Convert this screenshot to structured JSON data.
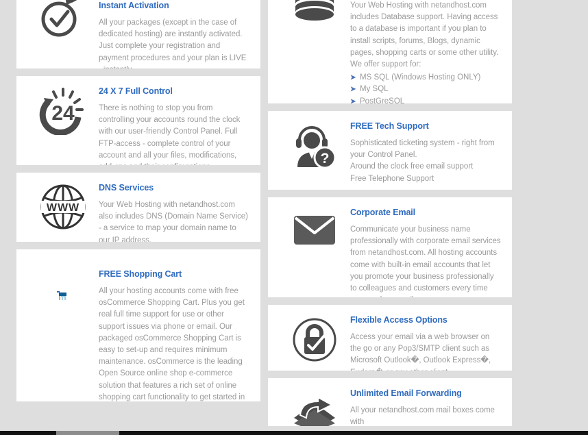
{
  "theme": {
    "page_background": "#dedede",
    "card_background": "#ffffff",
    "heading_color": "#2f6bbf",
    "body_color": "#9b9b9b",
    "icon_color": "#4a4a4a",
    "bullet_color": "#4a6fb5"
  },
  "left_column": {
    "cards": [
      {
        "id": "instant-activation",
        "icon": "check-circle-speed-icon",
        "title": "Instant Activation",
        "body": "All your packages (except in the case of dedicated hosting) are instantly activated. Just complete your registration and payment procedures and your plan is LIVE - instantly."
      },
      {
        "id": "full-control",
        "icon": "24-hour-clock-icon",
        "title": "24 X 7 Full Control",
        "body": "There is nothing to stop you from controlling your accounts round the clock with our user-friendly Control Panel. Full FTP-access - complete control of your account and all your files, modifications, add-ons and their configurations"
      },
      {
        "id": "dns-services",
        "icon": "www-globe-icon",
        "title": "DNS Services",
        "body": "Your Web Hosting with netandhost.com also includes DNS (Domain Name Service) - a service to map your domain name to our IP address."
      },
      {
        "id": "free-shopping-cart",
        "icon": "shopping-cart-icon",
        "title": "FREE Shopping Cart",
        "body": "All your hosting accounts come with free osCommerce Shopping Cart. Plus you get real full time support for use or other support issues via phone or email. Our packaged osCommerce Shopping Cart is easy to set-up and requires minimum maintenance. osCommerce is the leading Open Source online shop e-commerce solution that features a rich set of online shopping cart functionality to get started in selling physical and digital goods over Internet. You will get full control of the system from the Catalog front-end"
      }
    ]
  },
  "right_column": {
    "cards": [
      {
        "id": "database-support",
        "icon": "database-stack-icon",
        "title": "",
        "body": "Your Web Hosting with netandhost.com includes Database support. Having access to a database is important if you plan to install scripts, forums, Blogs, dynamic pages, shopping carts or some other utility. We offer support for:",
        "bullets": [
          "MS SQL (Windows Hosting ONLY)",
          "My SQL",
          "PostGreSQL"
        ]
      },
      {
        "id": "free-tech-support",
        "icon": "headset-agent-question-icon",
        "title": "FREE Tech Support",
        "body": "Sophisticated ticketing system - right from your Control Panel.\nAround the clock free email support\nFree Telephone Support"
      },
      {
        "id": "corporate-email",
        "icon": "envelope-icon",
        "title": "Corporate Email",
        "body": "Communicate your business name professionally with corporate email services from netandhost.com. All hosting accounts come with built-in email accounts that let you promote your business professionally to colleagues and customers every time you send an email."
      },
      {
        "id": "flexible-access-options",
        "icon": "lock-check-circle-icon",
        "title": "Flexible Access Options",
        "body": "Access your email via a web browser on the go or any Pop3/SMTP client such as Microsoft Outlook�, Outlook Express�, Eudora� or any other client."
      },
      {
        "id": "unlimited-email-forwarding",
        "icon": "mail-forward-icon",
        "title": "Unlimited Email Forwarding",
        "body": "All your netandhost.com mail boxes come with"
      }
    ]
  },
  "bullet_marker": "➤"
}
